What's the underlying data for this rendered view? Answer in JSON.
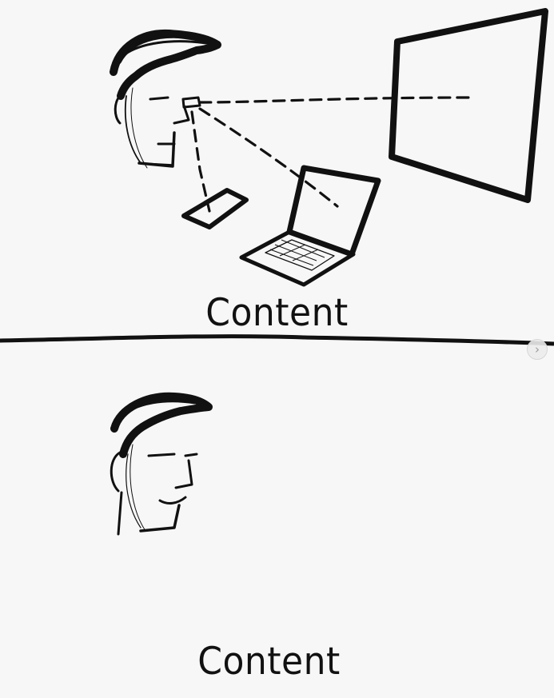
{
  "panels": {
    "top": {
      "caption": "Content"
    },
    "bottom": {
      "caption": "Content"
    }
  },
  "navigation": {
    "next_glyph": "›",
    "icon": "chevron-right-icon"
  },
  "colors": {
    "ink": "#111111",
    "paper": "#f7f7f7"
  }
}
